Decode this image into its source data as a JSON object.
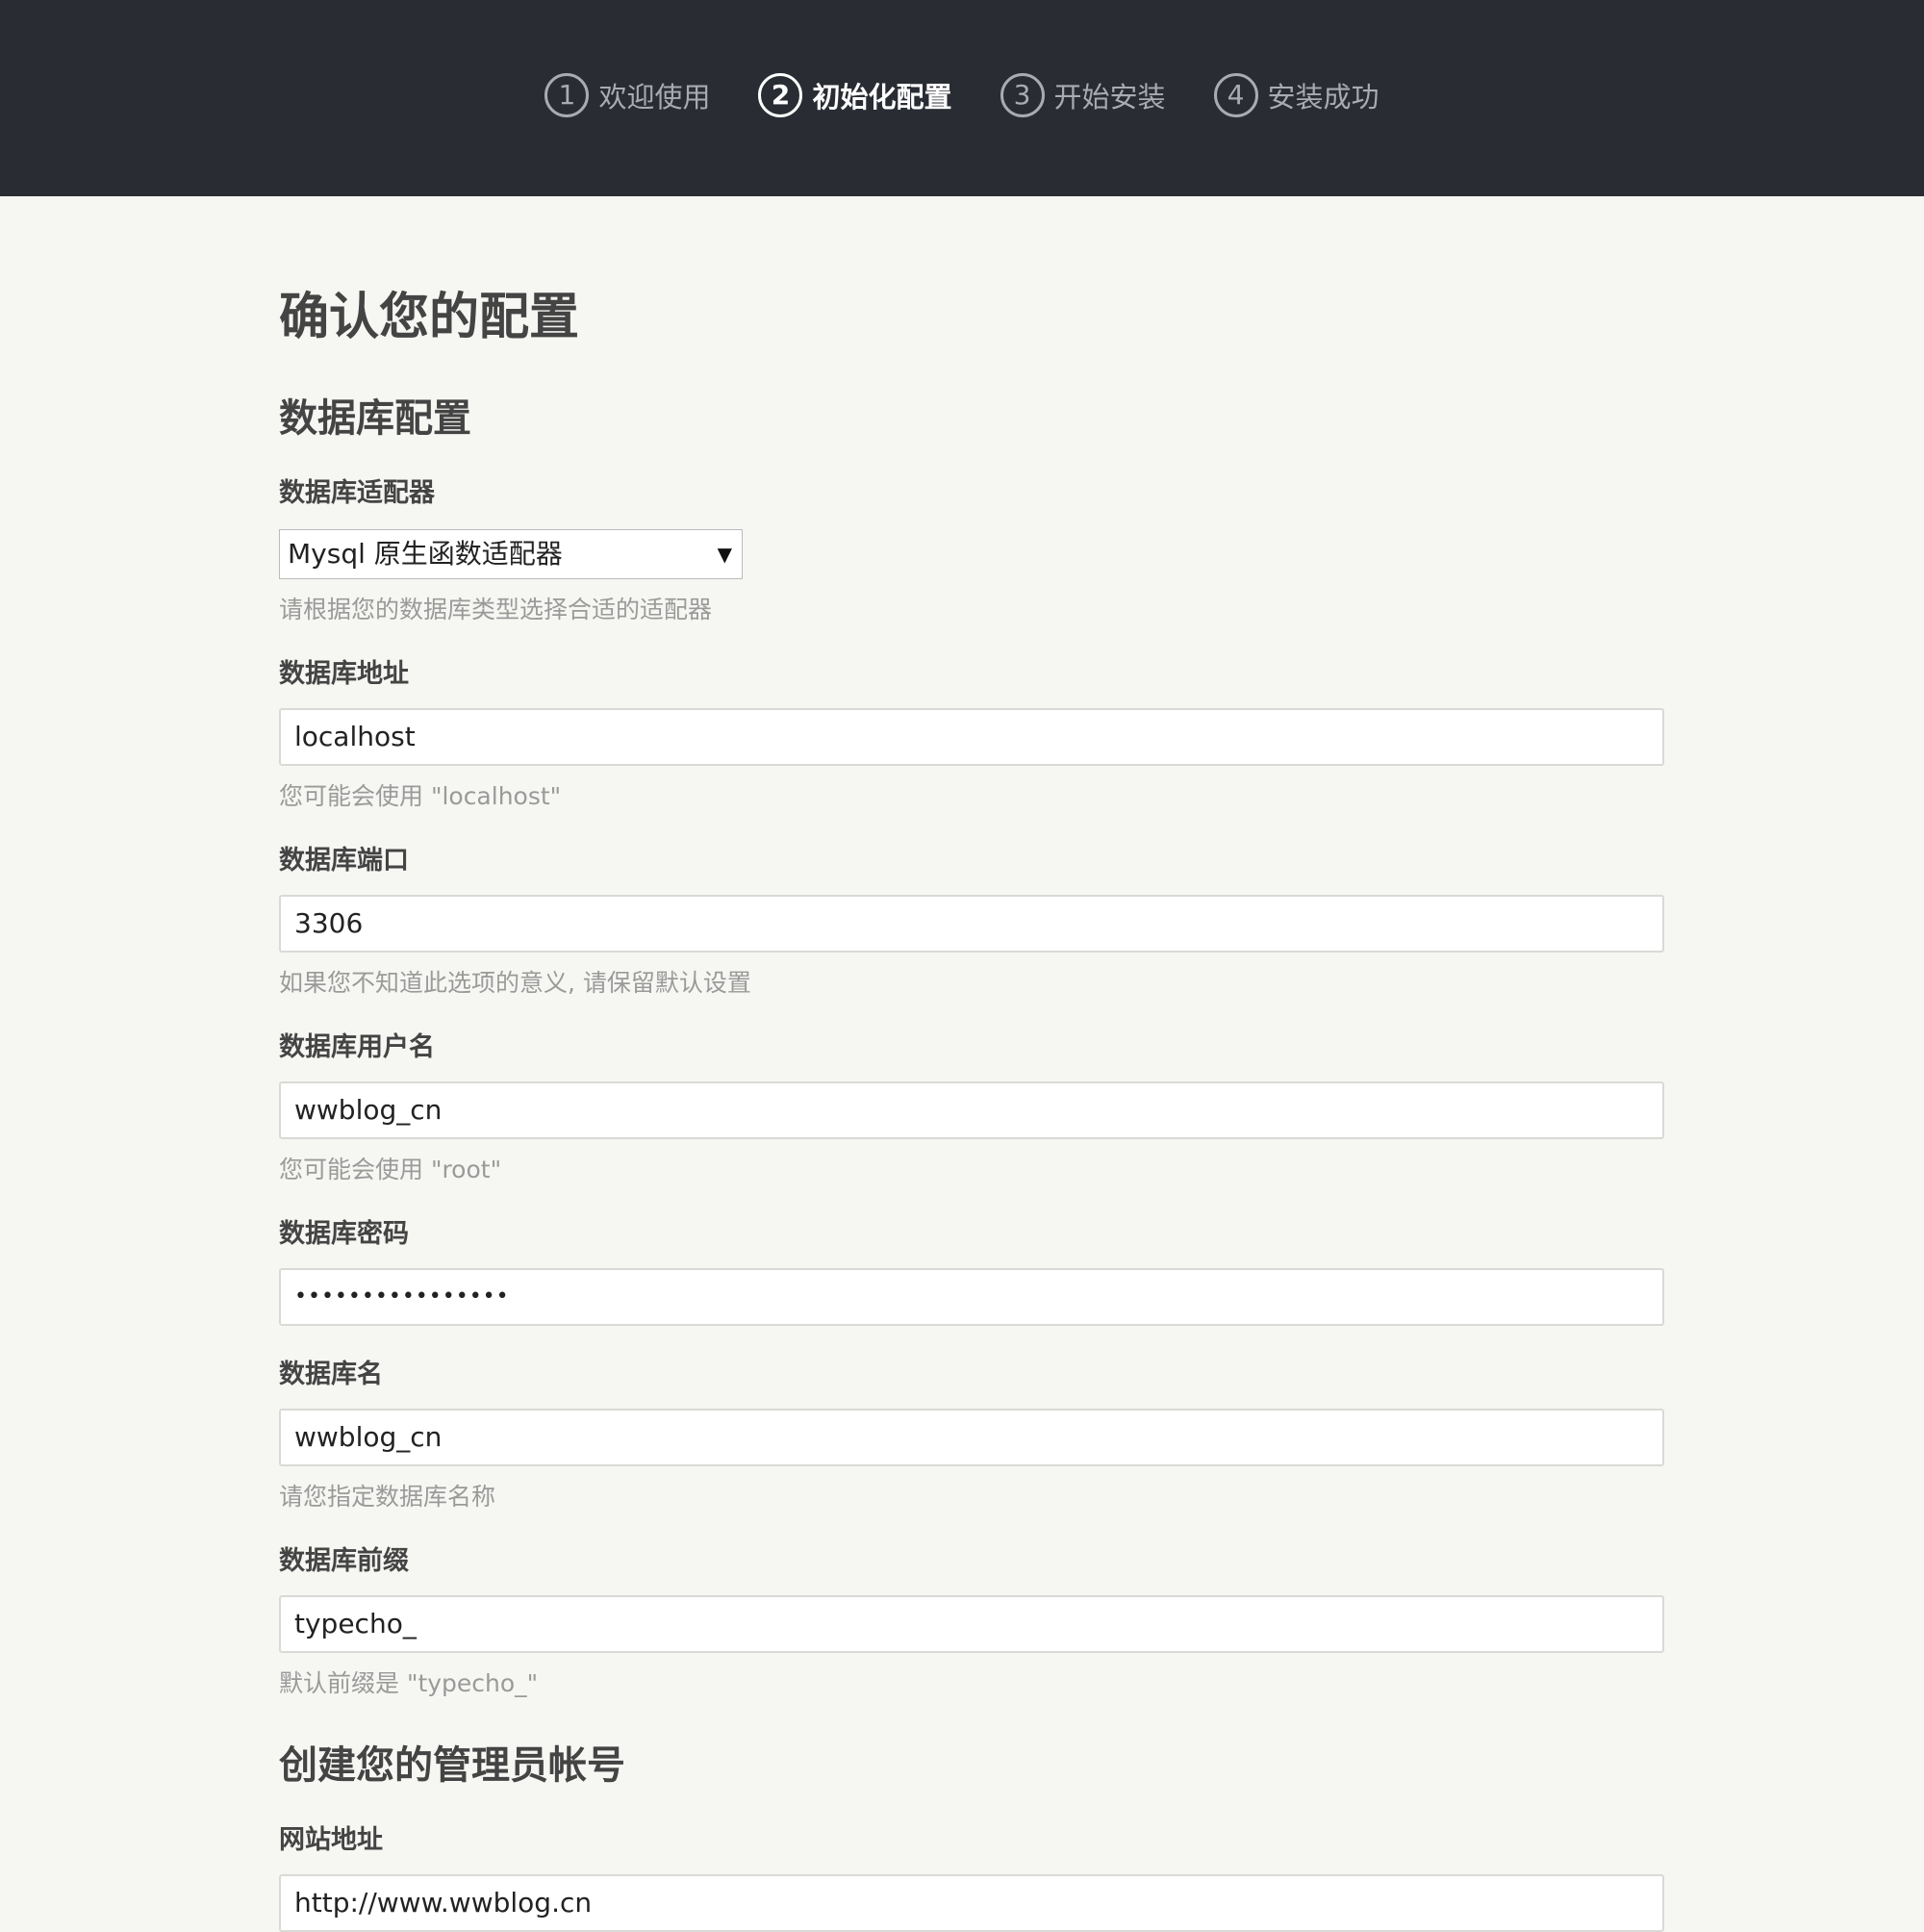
{
  "steps": [
    {
      "num": "1",
      "label": "欢迎使用"
    },
    {
      "num": "2",
      "label": "初始化配置"
    },
    {
      "num": "3",
      "label": "开始安装"
    },
    {
      "num": "4",
      "label": "安装成功"
    }
  ],
  "page_title": "确认您的配置",
  "db_section_title": "数据库配置",
  "adapter": {
    "label": "数据库适配器",
    "selected": "Mysql 原生函数适配器",
    "hint": "请根据您的数据库类型选择合适的适配器"
  },
  "host": {
    "label": "数据库地址",
    "value": "localhost",
    "hint": "您可能会使用 \"localhost\""
  },
  "port": {
    "label": "数据库端口",
    "value": "3306",
    "hint": "如果您不知道此选项的意义, 请保留默认设置"
  },
  "user": {
    "label": "数据库用户名",
    "value": "wwblog_cn",
    "hint": "您可能会使用 \"root\""
  },
  "password": {
    "label": "数据库密码",
    "value": "••••••••••••••••"
  },
  "dbname": {
    "label": "数据库名",
    "value": "wwblog_cn",
    "hint": "请您指定数据库名称"
  },
  "prefix": {
    "label": "数据库前缀",
    "value": "typecho_",
    "hint": "默认前缀是 \"typecho_\""
  },
  "admin_section_title": "创建您的管理员帐号",
  "site_url": {
    "label": "网站地址",
    "value": "http://www.wwblog.cn"
  }
}
